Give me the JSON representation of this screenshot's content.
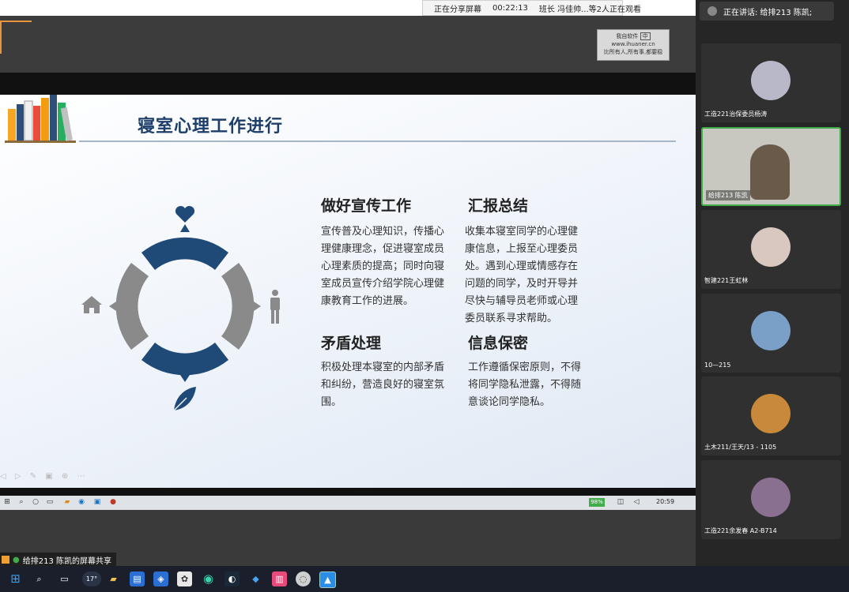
{
  "share_bar": {
    "status": "正在分享屏幕",
    "timer": "00:22:13",
    "viewers": "班长 冯佳帅...等2人正在观看"
  },
  "speaking": {
    "text": "正在讲话: 给排213 陈凯;"
  },
  "slide": {
    "title": "寝室心理工作进行",
    "sections": [
      {
        "title": "做好宣传工作",
        "body": "宣传普及心理知识，传播心理健康理念，促进寝室成员心理素质的提高；同时向寝室成员宣传介绍学院心理健康教育工作的进展。"
      },
      {
        "title": "汇报总结",
        "body": "收集本寝室同学的心理健康信息，上报至心理委员处。遇到心理或情感存在问题的同学，及时开导并尽快与辅导员老师或心理委员联系寻求帮助。"
      },
      {
        "title": "矛盾处理",
        "body": "积极处理本寝室的内部矛盾和纠纷，营造良好的寝室氛围。"
      },
      {
        "title": "信息保密",
        "body": "工作遵循保密原则，不得将同学隐私泄露，不得随意谈论同学隐私。"
      }
    ],
    "icons": [
      "heart-icon",
      "home-icon",
      "person-icon",
      "leaf-icon"
    ],
    "colors": {
      "accent_blue": "#1f4a78",
      "accent_gray": "#8a8a8a"
    }
  },
  "logo": {
    "line1": "我自软件",
    "line2": "www.ihuaner.cn",
    "line3": "比所有人,所有事,都要稳",
    "badge": "中"
  },
  "inner_taskbar": {
    "battery": "98%",
    "clock": "20:59"
  },
  "share_label": {
    "text": "给排213 陈凯的屏幕共享"
  },
  "participants": [
    {
      "name": "工造221治保委员杨涛",
      "avatar_color": "#b8b8c8"
    },
    {
      "name": "给排213 陈凯",
      "avatar_color": "#6a5a4a",
      "active": true
    },
    {
      "name": "智建221王虹林",
      "avatar_color": "#d8c8c0"
    },
    {
      "name": "10—215",
      "avatar_color": "#7aa0c8"
    },
    {
      "name": "土木211/王天/13 - 1105",
      "avatar_color": "#c88a3a"
    },
    {
      "name": "工造221余发春  A2-B714",
      "avatar_color": "#8a7090"
    }
  ],
  "taskbar": {
    "weather": "17°"
  }
}
